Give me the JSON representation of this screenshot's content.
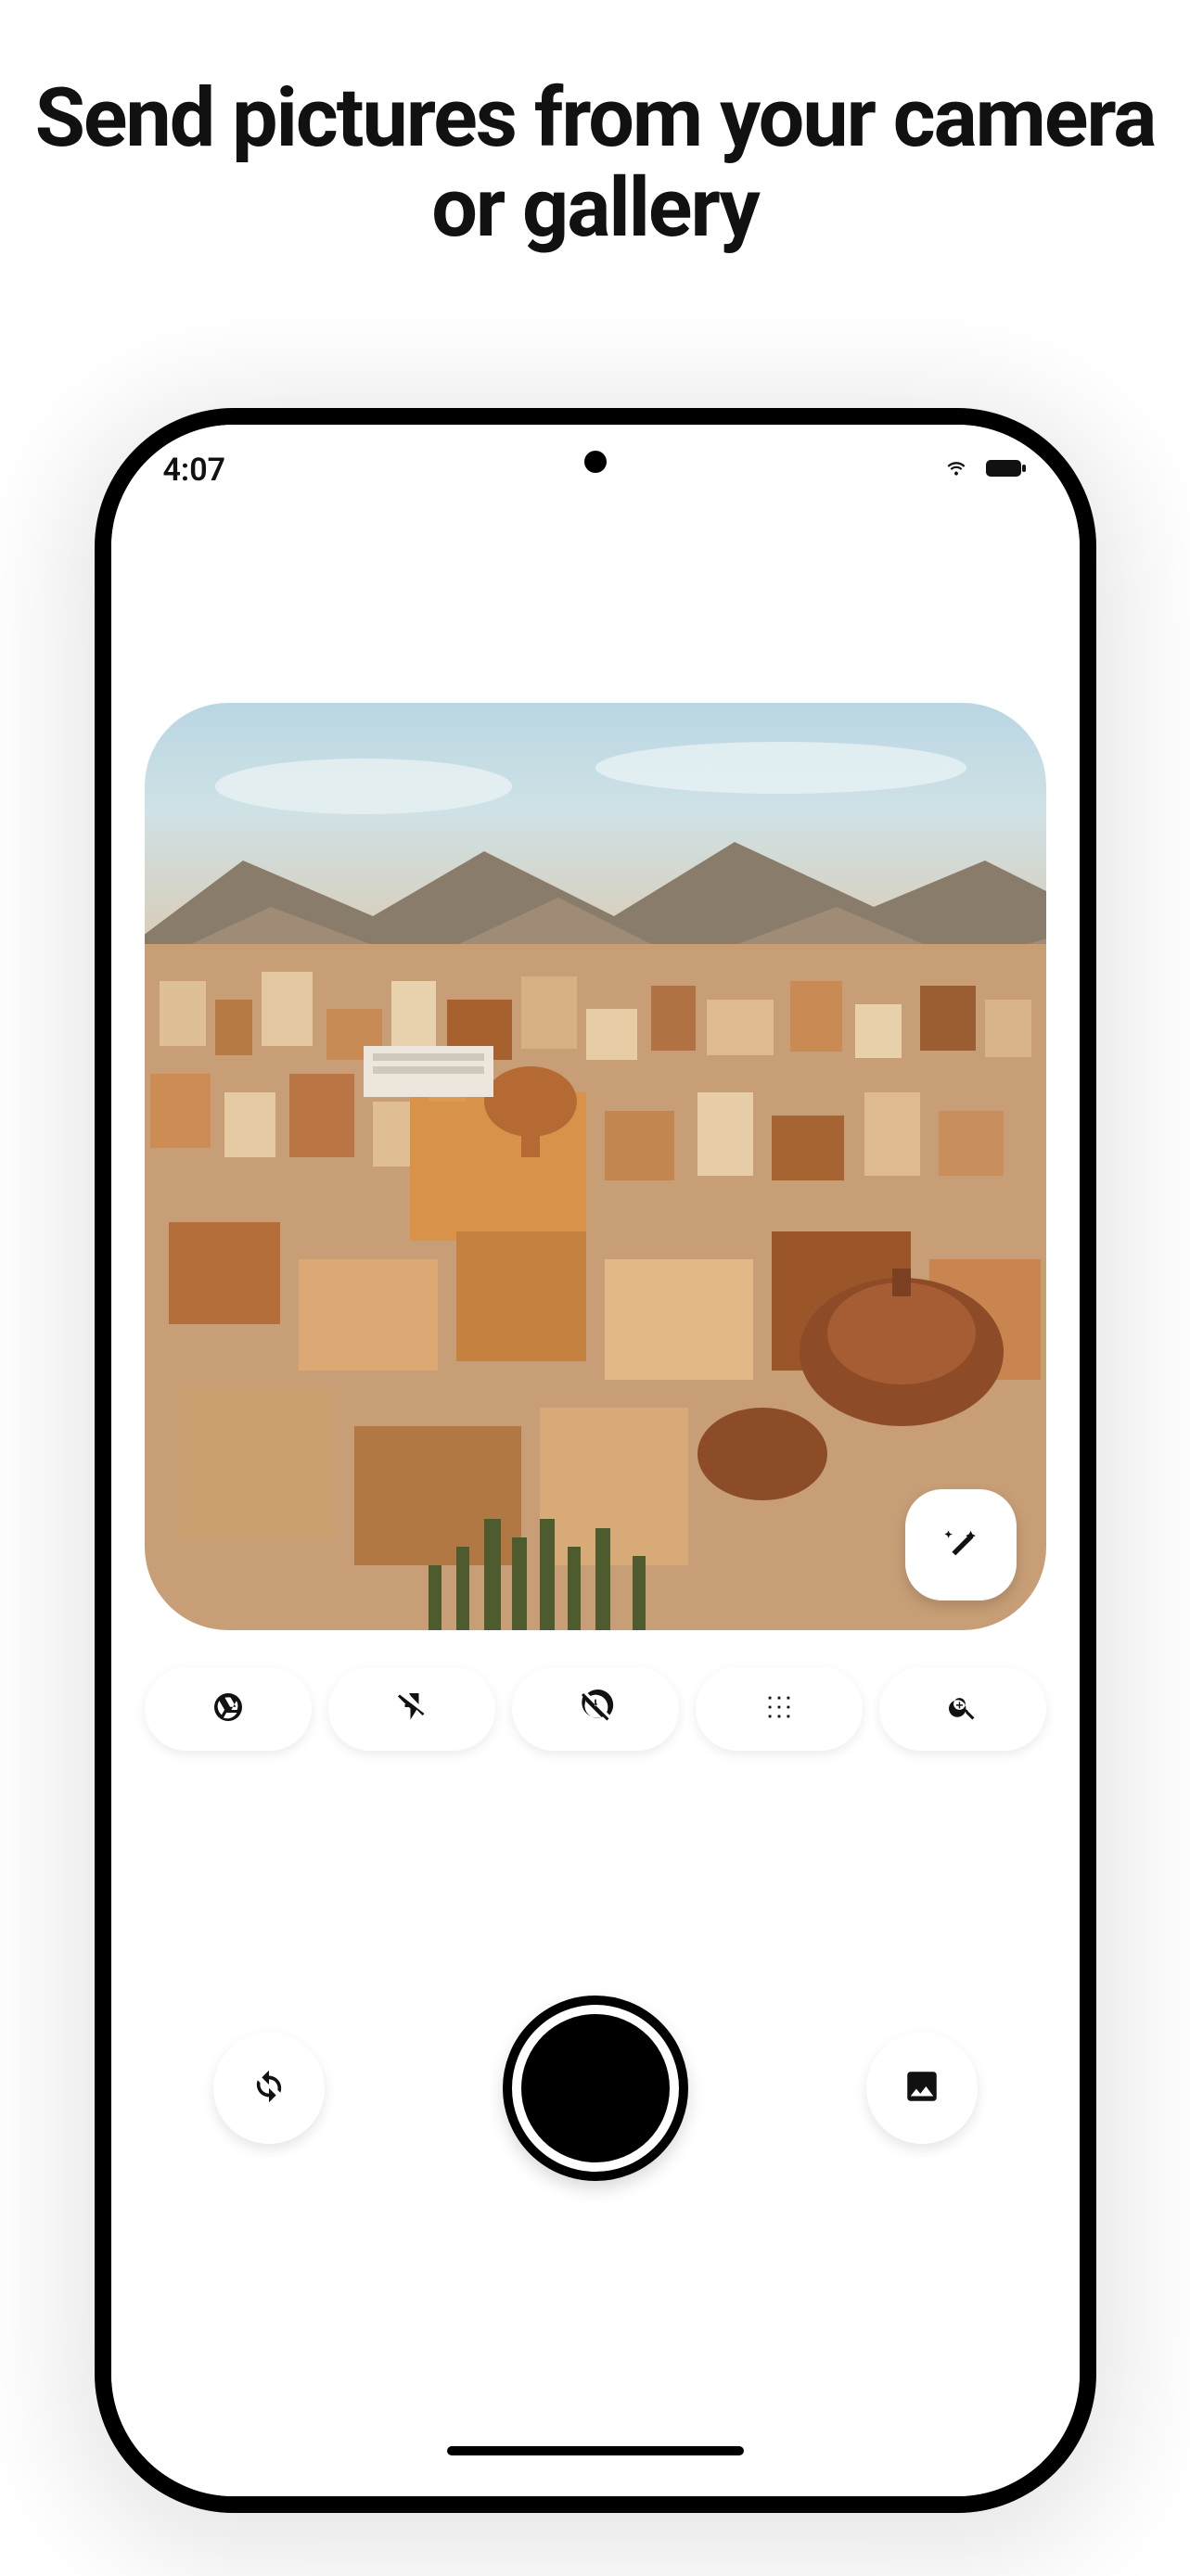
{
  "headline": "Send pictures from your camera or gallery",
  "status": {
    "time": "4:07",
    "wifi_icon": "wifi",
    "battery_icon": "battery"
  },
  "viewfinder": {
    "description": "cityscape-photo",
    "magic_button_icon": "magic-wand"
  },
  "options": [
    {
      "name": "aperture",
      "icon": "aperture-icon"
    },
    {
      "name": "flash-off",
      "icon": "flash-off-icon"
    },
    {
      "name": "timer-off",
      "icon": "timer-off-icon"
    },
    {
      "name": "grid",
      "icon": "grid-icon"
    },
    {
      "name": "zoom",
      "icon": "zoom-in-icon"
    }
  ],
  "controls": {
    "switch_camera_icon": "switch-camera",
    "shutter_icon": "shutter",
    "gallery_icon": "gallery"
  }
}
